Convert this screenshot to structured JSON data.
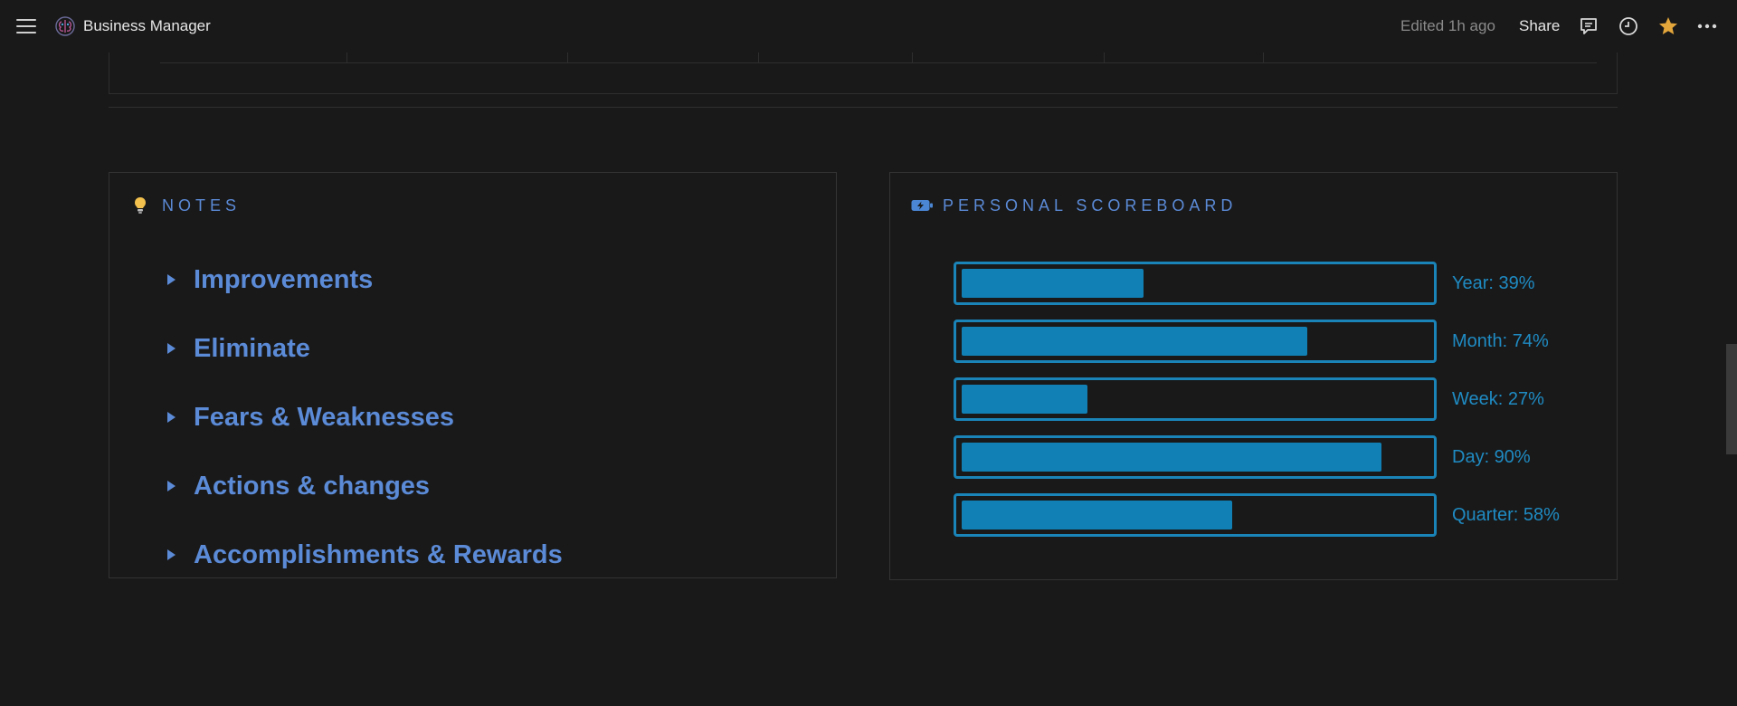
{
  "topbar": {
    "title": "Business Manager",
    "edited": "Edited 1h ago",
    "share_label": "Share",
    "icons": [
      "menu-icon",
      "brain-icon",
      "comment-icon",
      "clock-icon",
      "star-icon",
      "more-icon"
    ],
    "star_color": "#e3a63b"
  },
  "notes": {
    "header": "NOTES",
    "icon": "lightbulb-icon",
    "items": [
      {
        "label": "Improvements"
      },
      {
        "label": "Eliminate"
      },
      {
        "label": "Fears & Weaknesses"
      },
      {
        "label": "Actions & changes"
      },
      {
        "label": "Accomplishments & Rewards"
      }
    ]
  },
  "scoreboard": {
    "header": "PERSONAL SCOREBOARD",
    "icon": "battery-charging-icon",
    "accent": "#1181b5",
    "bars": [
      {
        "label": "Year: 39%",
        "percent": 39
      },
      {
        "label": "Month: 74%",
        "percent": 74
      },
      {
        "label": "Week: 27%",
        "percent": 27
      },
      {
        "label": "Day: 90%",
        "percent": 90
      },
      {
        "label": "Quarter: 58%",
        "percent": 58
      }
    ]
  }
}
